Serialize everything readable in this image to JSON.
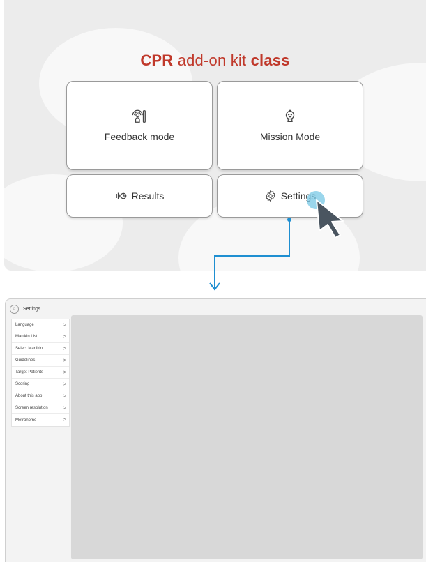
{
  "screen": {
    "title": {
      "part1": "CPR",
      "part2": "add-on kit",
      "part3": "class"
    },
    "buttons": [
      {
        "label": "Feedback mode",
        "icon": "feedback-mode-icon"
      },
      {
        "label": "Mission Mode",
        "icon": "mission-mode-icon"
      },
      {
        "label": "Results",
        "icon": "results-icon"
      },
      {
        "label": "Settings",
        "icon": "gear-icon"
      }
    ]
  },
  "settings_window": {
    "title": "Settings",
    "menu": [
      {
        "label": "Language",
        "chevron": ">"
      },
      {
        "label": "Manikin List",
        "chevron": ">"
      },
      {
        "label": "Select Manikin",
        "chevron": ">"
      },
      {
        "label": "Guidelines",
        "chevron": ">"
      },
      {
        "label": "Target Patients",
        "chevron": ">"
      },
      {
        "label": "Scoring",
        "chevron": ">"
      },
      {
        "label": "About this app",
        "chevron": ">"
      },
      {
        "label": "Screen resolution",
        "chevron": ">"
      },
      {
        "label": "Metronome",
        "chevron": ">"
      }
    ]
  },
  "colors": {
    "accent": "#c0392b",
    "connector": "#1f8fd1",
    "panel_bg": "#ececec",
    "content_bg": "#d8d8d8"
  }
}
